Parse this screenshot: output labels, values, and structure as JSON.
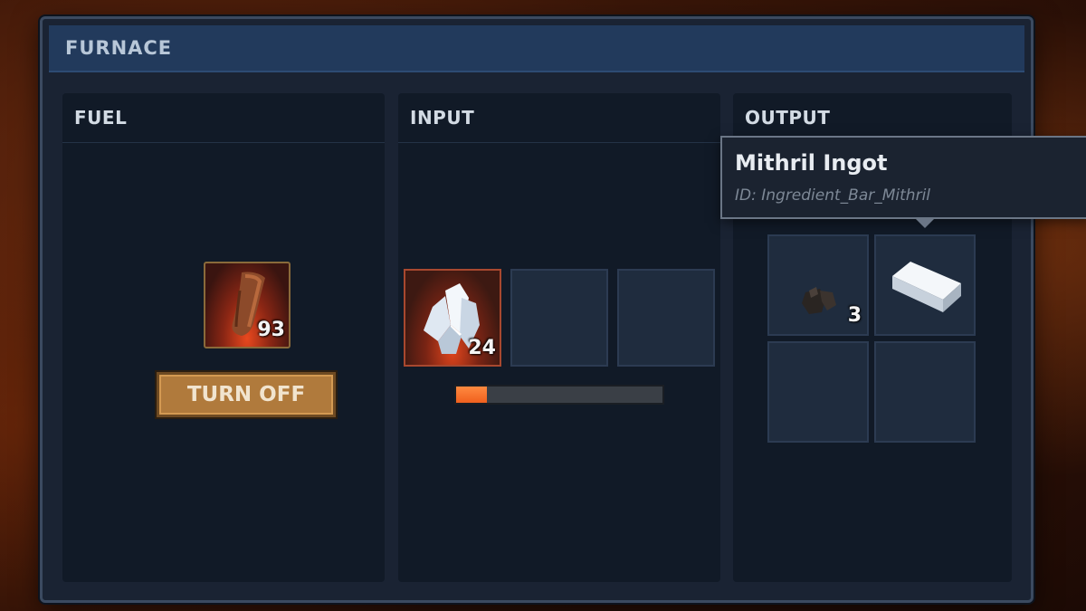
{
  "window": {
    "title": "FURNACE"
  },
  "fuel": {
    "header": "FUEL",
    "slot": {
      "item": "wood-log-icon",
      "count": "93"
    },
    "turn_off_label": "TURN OFF"
  },
  "input": {
    "header": "INPUT",
    "slots": [
      {
        "item": "mithril-ore-crystal-icon",
        "count": "24"
      },
      {
        "item": "",
        "count": ""
      },
      {
        "item": "",
        "count": ""
      }
    ],
    "progress_fraction": 0.15,
    "progress_color": "#f26a24"
  },
  "output": {
    "header": "OUTPUT",
    "slots": [
      {
        "item": "charcoal-icon",
        "count": "3"
      },
      {
        "item": "mithril-ingot-icon",
        "count": ""
      },
      {
        "item": "",
        "count": ""
      },
      {
        "item": "",
        "count": ""
      }
    ]
  },
  "tooltip": {
    "name": "Mithril Ingot",
    "id": "ID: Ingredient_Bar_Mithril"
  }
}
